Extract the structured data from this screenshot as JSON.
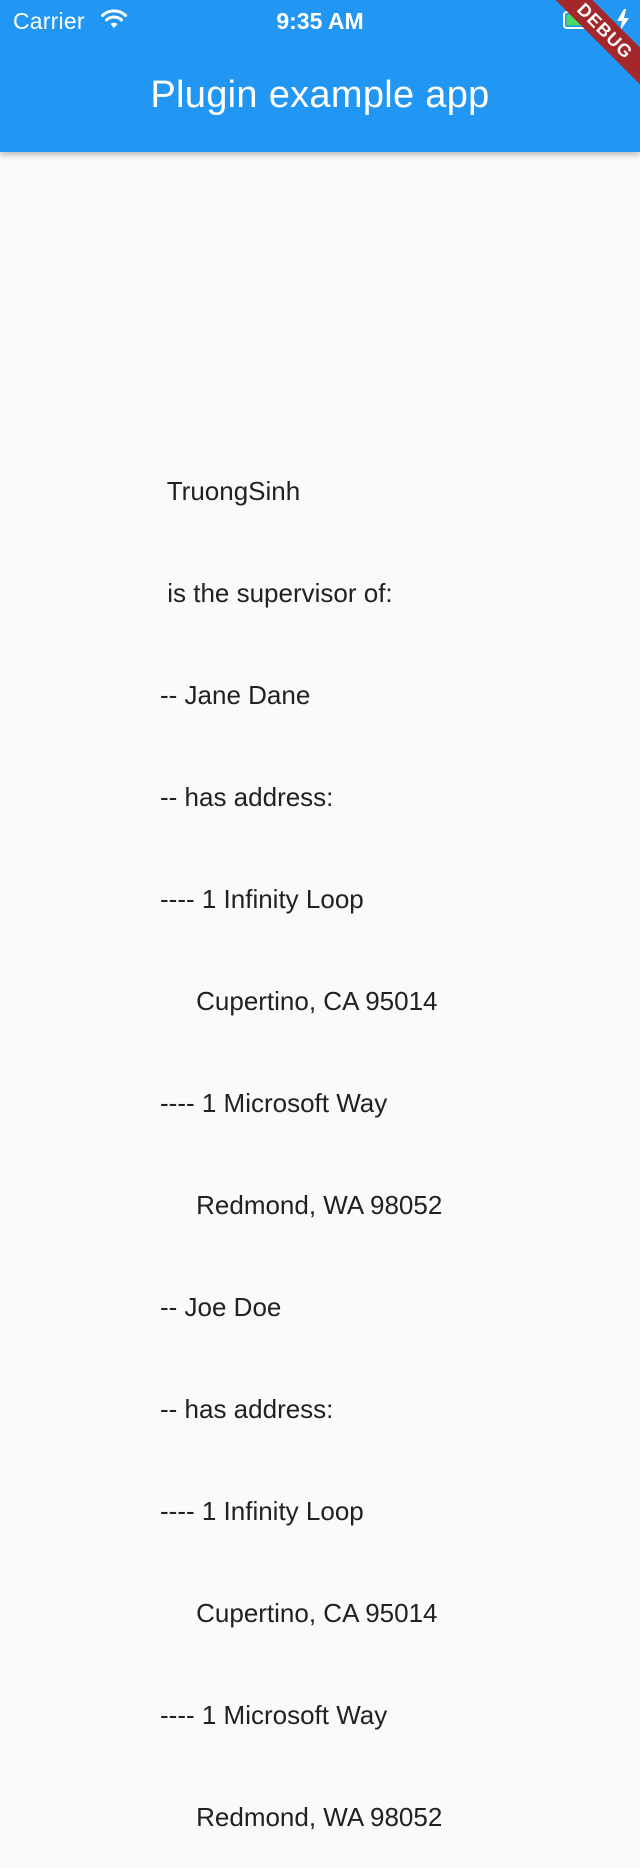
{
  "status_bar": {
    "carrier": "Carrier",
    "time": "9:35 AM"
  },
  "app_bar": {
    "title": "Plugin example app",
    "color": "#2196f3"
  },
  "debug_banner": {
    "label": "DEBUG",
    "color": "#a4272b"
  },
  "content": {
    "lines": [
      " TruongSinh",
      " is the supervisor of:",
      "-- Jane Dane",
      "-- has address:",
      "---- 1 Infinity Loop",
      "     Cupertino, CA 95014",
      "---- 1 Microsoft Way",
      "     Redmond, WA 98052",
      "-- Joe Doe",
      "-- has address:",
      "---- 1 Infinity Loop",
      "     Cupertino, CA 95014",
      "---- 1 Microsoft Way",
      "     Redmond, WA 98052"
    ]
  }
}
